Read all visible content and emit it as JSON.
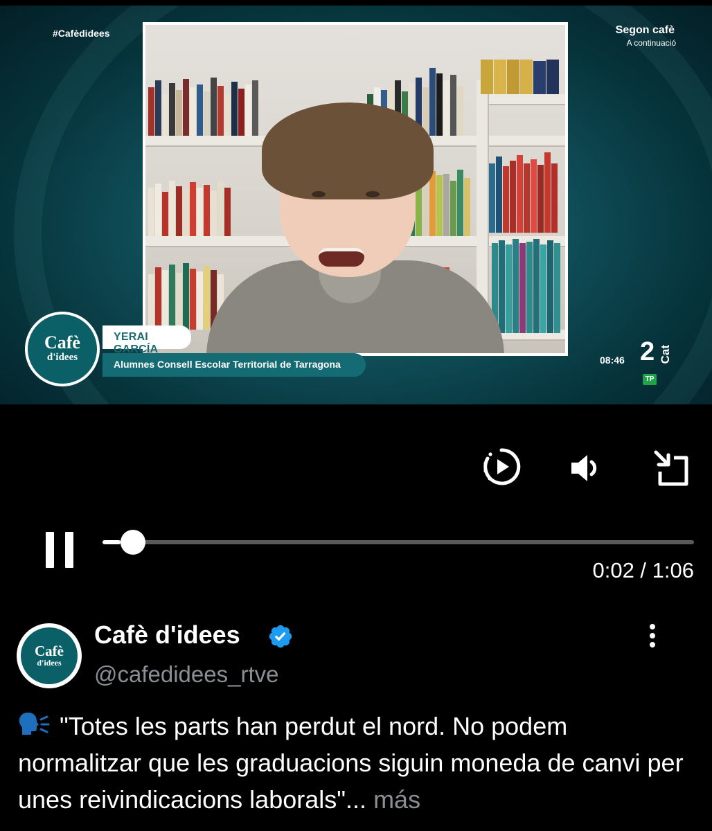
{
  "video": {
    "hashtag": "#Cafèdidees",
    "next_program_title": "Segon cafè",
    "next_program_subtitle": "A continuació",
    "logo_line1": "Cafè",
    "logo_line2": "d'idees",
    "guest_name": "YERAI GARCÍA",
    "guest_role": "Alumnes Consell Escolar Territorial de Tarragona",
    "clock": "08:46",
    "channel_number": "2",
    "channel_suffix": "Cat",
    "rating_badge": "TP"
  },
  "player": {
    "current_time": "0:02",
    "total_time": "1:06",
    "time_display": "0:02 / 1:06",
    "progress_fraction": 0.03,
    "icons": [
      "autoplay-icon",
      "volume-icon",
      "exit-fullscreen-icon",
      "pause-icon"
    ]
  },
  "post": {
    "display_name": "Cafè d'idees",
    "handle": "@cafedidees_rtve",
    "verified": true,
    "text": "\"Totes les parts han perdut el nord. No podem normalitzar que les graduacions siguin moneda de canvi per unes reivindicacions laborals\"...",
    "more_label": "más",
    "avatar_line1": "Cafè",
    "avatar_line2": "d'idees"
  },
  "colors": {
    "background": "#000000",
    "brand_teal": "#0b5f67",
    "verified_blue": "#1d9bf0",
    "muted_text": "#8b8f94"
  }
}
